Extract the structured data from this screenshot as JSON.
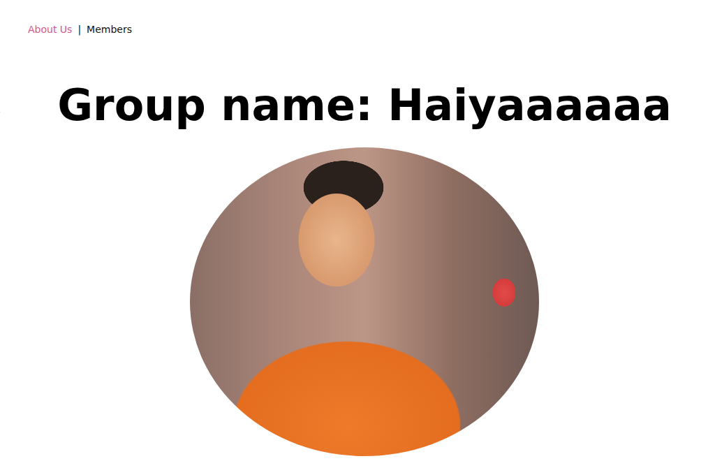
{
  "nav": {
    "items": [
      {
        "label": "About Us",
        "selected": true
      },
      {
        "label": "Members",
        "selected": false
      }
    ],
    "separator": "|"
  },
  "heading": "Group name: Haiyaaaaaa"
}
